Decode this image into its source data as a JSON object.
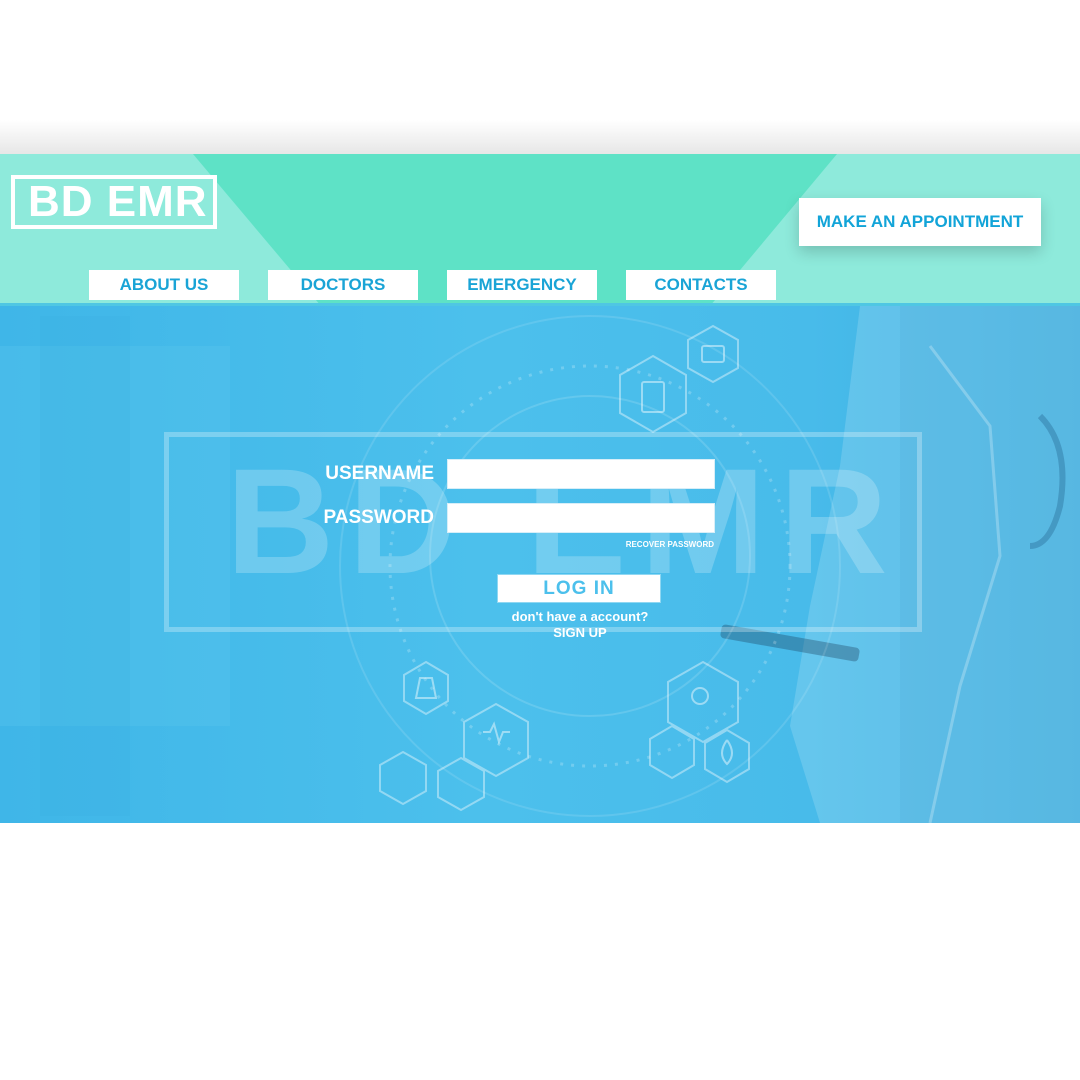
{
  "header": {
    "logo_text": "BD EMR",
    "appointment_label": "MAKE AN APPOINTMENT",
    "nav": [
      {
        "label": "ABOUT US"
      },
      {
        "label": "DOCTORS"
      },
      {
        "label": "EMERGENCY"
      },
      {
        "label": "CONTACTS"
      }
    ]
  },
  "login": {
    "watermark": "BD EMR",
    "username_label": "USERNAME",
    "password_label": "PASSWORD",
    "username_value": "",
    "password_value": "",
    "recover_label": "RECOVER PASSWORD",
    "login_label": "LOG IN",
    "no_account_text": "don't have a account?",
    "signup_label": "SIGN UP"
  },
  "colors": {
    "header_light": "#8eeadb",
    "header_accent": "#5ee2c6",
    "hero_blue": "#4cc0ec",
    "button_text": "#12a4d8"
  },
  "icons": [
    "first-aid-kit-icon",
    "clipboard-icon",
    "heart-monitor-icon",
    "flask-icon",
    "pills-icon",
    "drop-icon",
    "hexagon-icon"
  ]
}
